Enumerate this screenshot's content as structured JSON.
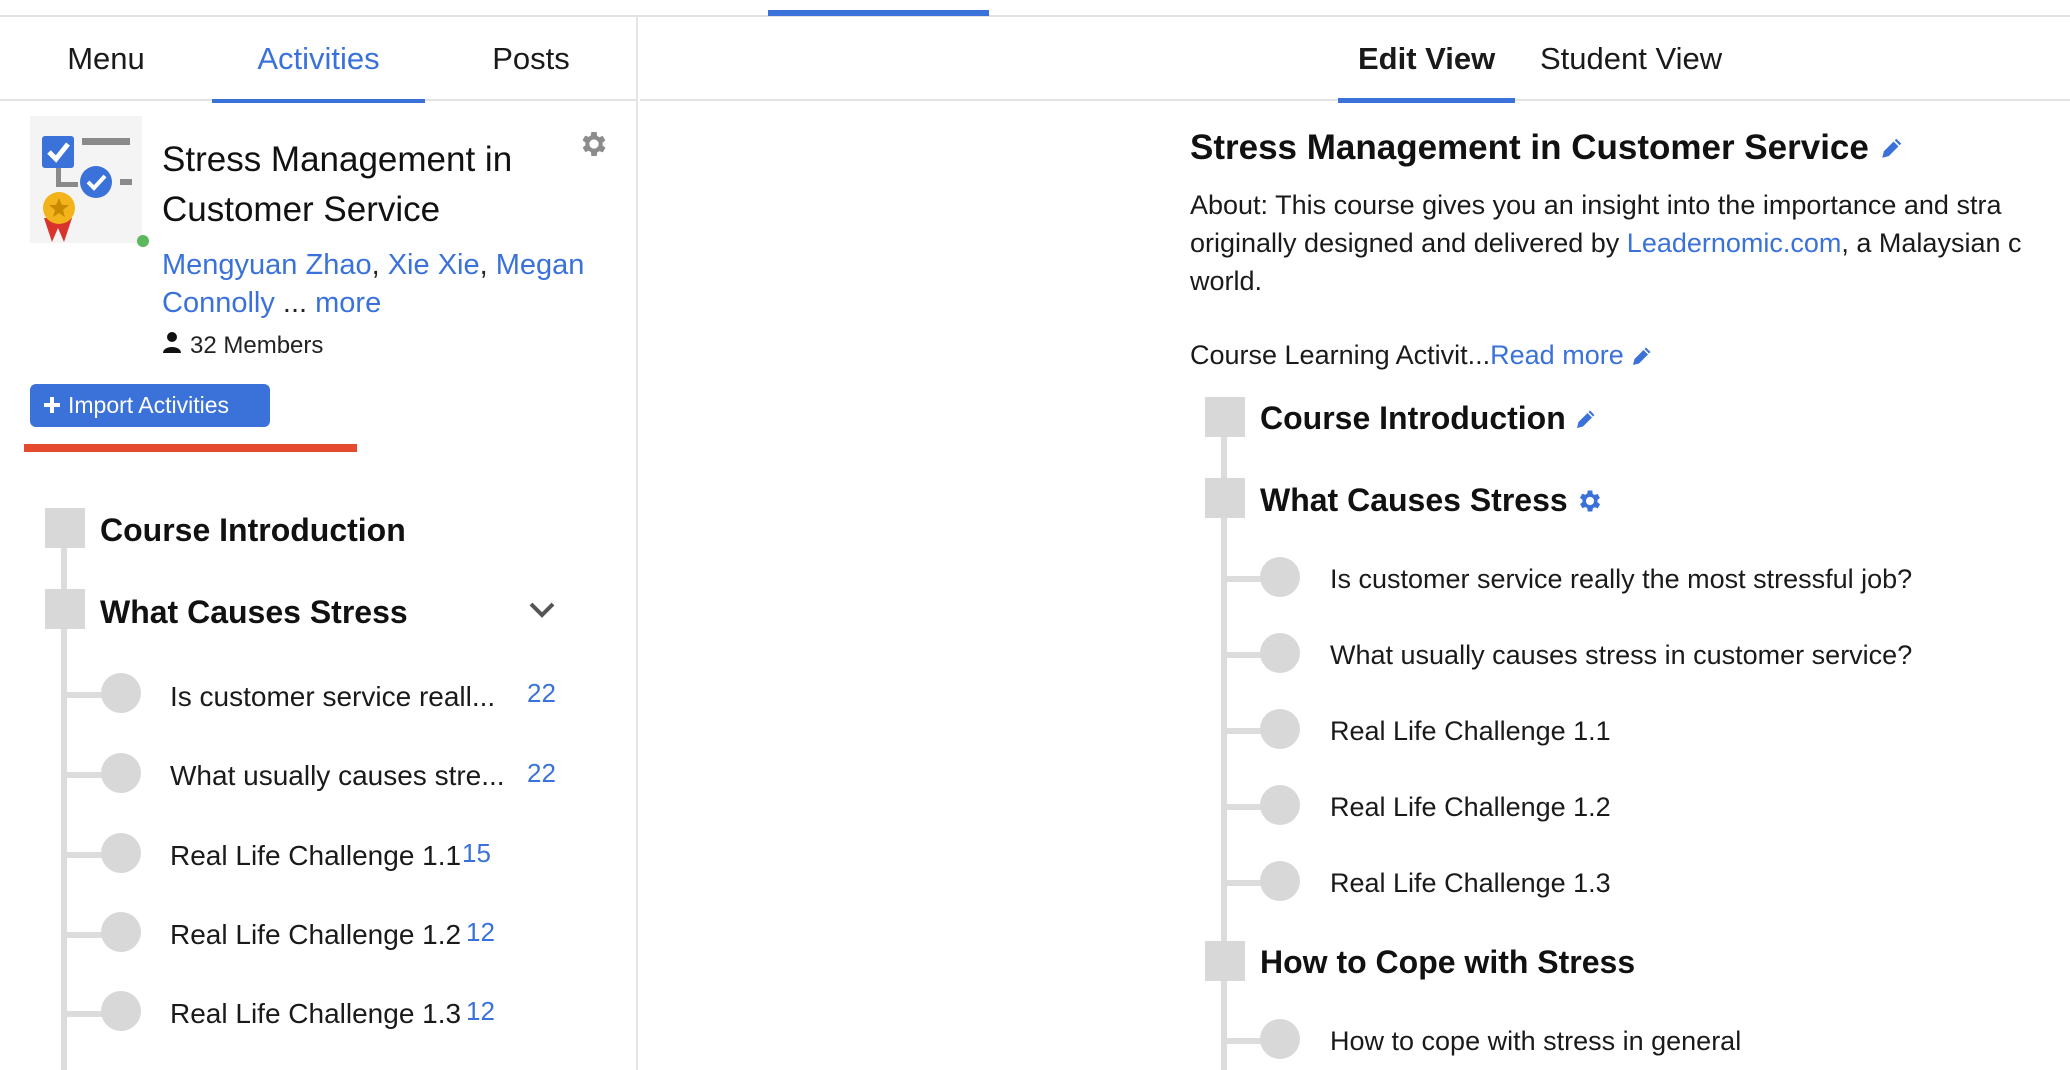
{
  "left_panel": {
    "tabs": [
      {
        "label": "Menu",
        "active": false
      },
      {
        "label": "Activities",
        "active": true
      },
      {
        "label": "Posts",
        "active": false
      }
    ],
    "course_title": "Stress Management in Customer Service",
    "authors": [
      "Mengyuan Zhao",
      "Xie Xie",
      "Megan Connolly"
    ],
    "authors_ellipsis": "...",
    "more_link": "more",
    "members": "32 Members",
    "import_button": "Import Activities",
    "sections": [
      {
        "title": "Course Introduction"
      },
      {
        "title": "What Causes Stress",
        "expanded": true,
        "activities": [
          {
            "label": "Is customer service reall...",
            "count": "22"
          },
          {
            "label": "What usually causes stre...",
            "count": "22"
          },
          {
            "label": "Real Life Challenge 1.1",
            "count": "15"
          },
          {
            "label": "Real Life Challenge 1.2",
            "count": "12"
          },
          {
            "label": "Real Life Challenge 1.3",
            "count": "12"
          }
        ]
      }
    ]
  },
  "right_panel": {
    "tabs": [
      {
        "label": "Edit View",
        "active": true
      },
      {
        "label": "Student View",
        "active": false
      }
    ],
    "title": "Stress Management in Customer Service",
    "about_line1": "About: This course gives you an insight into the importance and stra",
    "about_line2_pre": "originally designed and delivered by ",
    "about_link": "Leadernomic.com",
    "about_line2_post": ", a Malaysian c",
    "about_line3": "world.",
    "learning_activities_label": "Course Learning Activit...",
    "read_more": "Read more",
    "sections": [
      {
        "title": "Course Introduction",
        "icon": "pencil-icon"
      },
      {
        "title": "What Causes Stress",
        "icon": "gear-icon",
        "activities": [
          "Is customer service really the most stressful job?",
          "What usually causes stress in customer service?",
          "Real Life Challenge 1.1",
          "Real Life Challenge 1.2",
          "Real Life Challenge 1.3"
        ]
      },
      {
        "title": "How to Cope with Stress",
        "activities": [
          "How to cope with stress in general"
        ]
      }
    ]
  },
  "colors": {
    "accent": "#3b72d9",
    "highlight": "#e64a2e",
    "online": "#5cb85c",
    "timeline": "#d8d8d8"
  }
}
